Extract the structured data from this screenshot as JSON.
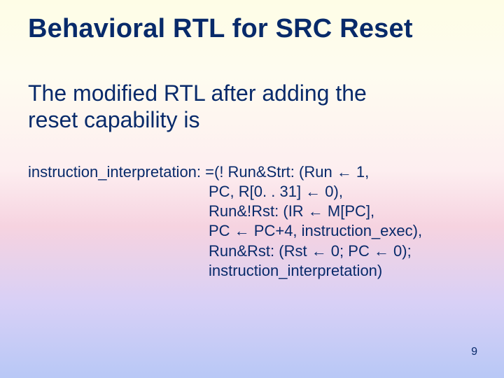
{
  "title": "Behavioral RTL for SRC Reset",
  "body_line1": "The modified RTL after adding the",
  "body_line2": "reset capability is",
  "rtl": {
    "l1": "instruction_interpretation: =(! Run&Strt: (Run ← 1,",
    "l2": "PC, R[0. . 31] ← 0),",
    "l3": "Run&!Rst: (IR ← M[PC],",
    "l4": "PC ← PC+4, instruction_exec),",
    "l5": "Run&Rst: (Rst ← 0; PC ← 0);",
    "l6": "instruction_interpretation)"
  },
  "page_number": "9"
}
